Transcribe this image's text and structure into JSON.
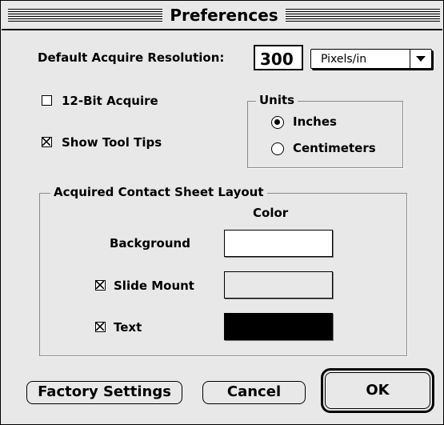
{
  "window": {
    "title": "Preferences"
  },
  "resolution": {
    "label": "Default Acquire Resolution:",
    "value": "300",
    "unit": "Pixels/in"
  },
  "options": {
    "bit12": {
      "label": "12-Bit Acquire",
      "checked": false
    },
    "tooltips": {
      "label": "Show Tool Tips",
      "checked": true
    }
  },
  "units": {
    "title": "Units",
    "inches": {
      "label": "Inches",
      "selected": true
    },
    "centimeters": {
      "label": "Centimeters",
      "selected": false
    }
  },
  "contact_sheet": {
    "title": "Acquired Contact Sheet Layout",
    "color_header": "Color",
    "background": {
      "label": "Background",
      "color": "#ffffff"
    },
    "slide_mount": {
      "label": "Slide Mount",
      "checked": true,
      "color": "#e8e8e8"
    },
    "text": {
      "label": "Text",
      "checked": true,
      "color": "#000000"
    }
  },
  "buttons": {
    "factory": "Factory Settings",
    "cancel": "Cancel",
    "ok": "OK"
  }
}
